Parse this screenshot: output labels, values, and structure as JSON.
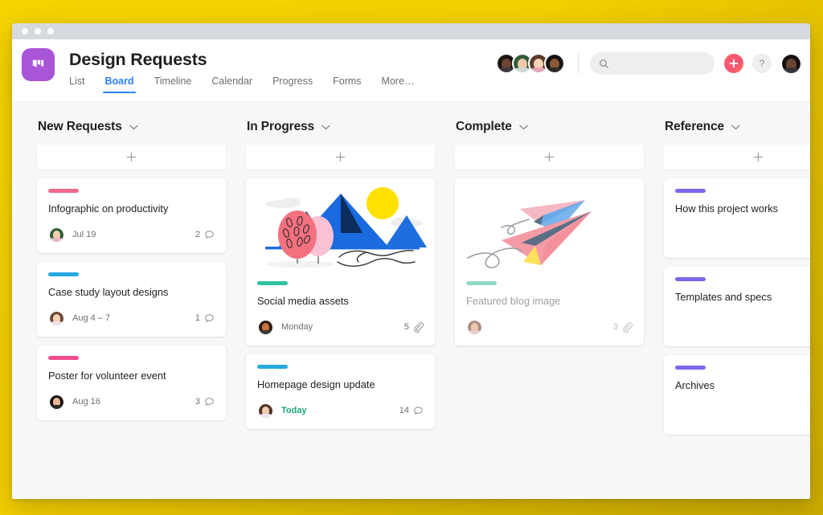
{
  "window": {
    "traffic_lights": [
      "close",
      "minimize",
      "maximize"
    ]
  },
  "header": {
    "logo_icon": "board-logo-icon",
    "logo_color": "#a855d8",
    "project_title": "Design Requests",
    "tabs": [
      {
        "label": "List",
        "active": false
      },
      {
        "label": "Board",
        "active": true
      },
      {
        "label": "Timeline",
        "active": false
      },
      {
        "label": "Calendar",
        "active": false
      },
      {
        "label": "Progress",
        "active": false
      },
      {
        "label": "Forms",
        "active": false
      },
      {
        "label": "More…",
        "active": false
      }
    ],
    "active_tab_color": "#2a7ff3",
    "members": [
      {
        "name": "member-1",
        "skin": "#6b4433",
        "hair": "#1b1411",
        "shirt": "#3d3a42",
        "bg": "#d7dde0"
      },
      {
        "name": "member-2",
        "skin": "#f0c9a8",
        "hair": "#2f5d3a",
        "shirt": "#cfd9d3",
        "bg": "#e8eceb"
      },
      {
        "name": "member-3",
        "skin": "#f6d2b6",
        "hair": "#5b3a2a",
        "shirt": "#e8a7b8",
        "bg": "#ded2ea"
      },
      {
        "name": "member-4",
        "skin": "#8a5a36",
        "hair": "#181313",
        "shirt": "#2e2b2b",
        "bg": "#ddd39a"
      }
    ],
    "search": {
      "placeholder": "",
      "value": "",
      "icon": "search-icon"
    },
    "add_button": {
      "icon": "plus-icon",
      "color": "#f9526f"
    },
    "help_button": {
      "label": "?"
    },
    "current_user_avatar": {
      "name": "current-user-avatar",
      "skin": "#6b4433",
      "hair": "#16110f",
      "shirt": "#36333a",
      "bg": "#cfd9dd"
    }
  },
  "board": {
    "columns": [
      {
        "id": "new-requests",
        "title": "New Requests",
        "add_label": "+",
        "cards": [
          {
            "title": "Infographic on productivity",
            "tag_color": "#f06a8a",
            "date": "Jul 19",
            "date_highlight": false,
            "count": "2",
            "count_icon": "comment-icon",
            "cover": null,
            "dim": false,
            "avatar": {
              "name": "assignee-avatar",
              "skin": "#f3cdb2",
              "hair": "#2f5d3a",
              "shirt": "#e6b7c4",
              "bg": "#e8eceb"
            }
          },
          {
            "title": "Case study layout designs",
            "tag_color": "#26a8e0",
            "date": "Aug 4 – 7",
            "date_highlight": false,
            "count": "1",
            "count_icon": "comment-icon",
            "cover": null,
            "dim": false,
            "avatar": {
              "name": "assignee-avatar",
              "skin": "#f6d2b6",
              "hair": "#6b4a34",
              "shirt": "#f0e2e8",
              "bg": "#e4dcef"
            }
          },
          {
            "title": "Poster for volunteer event",
            "tag_color": "#ef4b8f",
            "date": "Aug 16",
            "date_highlight": false,
            "count": "3",
            "count_icon": "comment-icon",
            "cover": null,
            "dim": false,
            "avatar": {
              "name": "assignee-avatar",
              "skin": "#e9b997",
              "hair": "#17120f",
              "shirt": "#2b2b2b",
              "bg": "#cfe3e2"
            }
          }
        ]
      },
      {
        "id": "in-progress",
        "title": "In Progress",
        "add_label": "+",
        "cards": [
          {
            "title": "Social media assets",
            "tag_color": "#2ec2a0",
            "date": "Monday",
            "date_highlight": false,
            "count": "5",
            "count_icon": "attachment-icon",
            "cover": "mountains-illustration",
            "dim": false,
            "avatar": {
              "name": "assignee-avatar",
              "skin": "#c8713f",
              "hair": "#2a1b12",
              "shirt": "#3a3a3a",
              "bg": "#f0b6b6"
            }
          },
          {
            "title": "Homepage design update",
            "tag_color": "#26a8e0",
            "date": "Today",
            "date_highlight": true,
            "count": "14",
            "count_icon": "comment-icon",
            "cover": null,
            "dim": false,
            "avatar": {
              "name": "assignee-avatar",
              "skin": "#f3cbb0",
              "hair": "#4e3426",
              "shirt": "#ece6f3",
              "bg": "#d8c9ec"
            }
          }
        ]
      },
      {
        "id": "complete",
        "title": "Complete",
        "add_label": "+",
        "cards": [
          {
            "title": "Featured blog image",
            "tag_color": "#8fd9c6",
            "date": "",
            "date_highlight": false,
            "count": "3",
            "count_icon": "attachment-icon",
            "cover": "paper-planes-illustration",
            "dim": true,
            "avatar": {
              "name": "assignee-avatar",
              "skin": "#e4a383",
              "hair": "#7a4a33",
              "shirt": "#d8b1b1",
              "bg": "#f7d9d9"
            }
          }
        ]
      },
      {
        "id": "reference",
        "title": "Reference",
        "add_label": "+",
        "cards": [
          {
            "title": "How this project works",
            "tag_color": "#7b68ee",
            "date": "",
            "date_highlight": false,
            "count": "",
            "count_icon": "",
            "cover": null,
            "dim": false,
            "avatar": null
          },
          {
            "title": "Templates and specs",
            "tag_color": "#7b68ee",
            "date": "",
            "date_highlight": false,
            "count": "",
            "count_icon": "",
            "cover": null,
            "dim": false,
            "avatar": null
          },
          {
            "title": "Archives",
            "tag_color": "#7b68ee",
            "date": "",
            "date_highlight": false,
            "count": "",
            "count_icon": "",
            "cover": null,
            "dim": false,
            "avatar": null
          }
        ]
      }
    ]
  },
  "theme": {
    "page_background": "#f2cf00",
    "board_background": "#f6f7f8",
    "card_background": "#ffffff",
    "text_primary": "#1e1f21",
    "text_secondary": "#6d6e6f",
    "accent_blue": "#2a7ff3",
    "accent_green": "#1fa67a"
  }
}
